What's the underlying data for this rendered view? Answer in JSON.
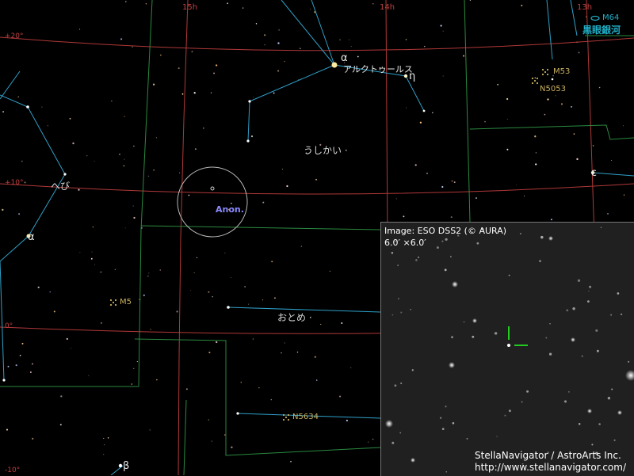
{
  "ra_labels": [
    "15h",
    "14h",
    "13h"
  ],
  "dec_labels": [
    "+20°",
    "+10°",
    "0°",
    "-10°"
  ],
  "constellations": {
    "bootes": "うしかい",
    "virgo": "おとめ",
    "serpens": "へび"
  },
  "stars": {
    "arcturus_greek": "α",
    "arcturus_name": "アルクトゥールス",
    "eta": "η",
    "epsilon": "ε",
    "serpens_alpha": "α",
    "beta": "β"
  },
  "objects": {
    "target": "Anon.",
    "m5": "M5",
    "m53": "M53",
    "n5053": "N5053",
    "m64": "M64",
    "m64_name": "黒眼銀河",
    "n5634": "N5634"
  },
  "inset": {
    "source": "Image: ESO DSS2 (© AURA)",
    "fov": "6.0′ ×6.0′"
  },
  "credit": {
    "line1": "StellaNavigator / AstroArts Inc.",
    "line2": "http://www.stellanavigator.com/"
  },
  "colors": {
    "ra_dec_grid": "#c04040",
    "constellation_lines": "#2fa0c8",
    "constellation_boundaries": "#2f9a4a",
    "target_marker": "#b8b8b8",
    "target_label": "#8a8aff",
    "dso": "#c8b060",
    "m64": "#20b0c8",
    "crosshair": "#22cc22"
  }
}
